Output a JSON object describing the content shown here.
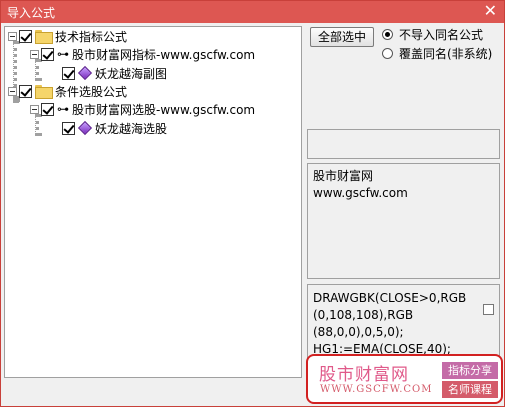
{
  "window": {
    "title": "导入公式",
    "close_glyph": "✕"
  },
  "tree": {
    "nodes": [
      {
        "label": "技术指标公式",
        "checked": true,
        "icon": "folder-icon"
      },
      {
        "label": "股市财富网指标-www.gscfw.com",
        "checked": true,
        "icon": "key-icon"
      },
      {
        "label": "妖龙越海副图",
        "checked": true,
        "icon": "formula-gem-icon"
      },
      {
        "label": "条件选股公式",
        "checked": true,
        "icon": "folder-icon"
      },
      {
        "label": "股市财富网选股-www.gscfw.com",
        "checked": true,
        "icon": "key-icon"
      },
      {
        "label": "妖龙越海选股",
        "checked": true,
        "icon": "formula-gem-icon"
      }
    ],
    "key_glyph": "⊶"
  },
  "controls": {
    "select_all_label": "全部选中",
    "radio_no_import": "不导入同名公式",
    "radio_overwrite": "覆盖同名(非系统)",
    "selected_option": "不导入同名公式"
  },
  "info": {
    "line1": "股市财富网",
    "line2": "www.gscfw.com"
  },
  "code": {
    "lines": [
      "DRAWGBK(CLOSE>0,RGB",
      "(0,108,108),RGB",
      "(88,0,0),0,5,0);",
      "HG1:=EMA(CLOSE,40);"
    ]
  },
  "watermark": {
    "title": "股市财富网",
    "url": "WWW.GSCFW.COM",
    "tag1": "指标分享",
    "tag2": "名师课程"
  },
  "colors": {
    "titlebar": "#dd5752",
    "watermark_border": "#d22121",
    "watermark_text": "#e05a8a"
  }
}
